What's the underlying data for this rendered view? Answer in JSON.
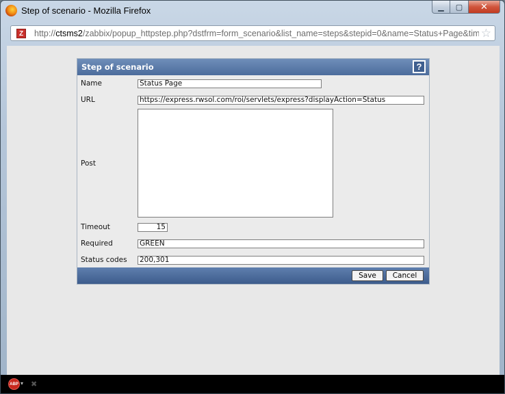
{
  "window": {
    "title": "Step of scenario - Mozilla Firefox",
    "url_prefix": "http://",
    "url_host": "ctsms2",
    "url_rest": "/zabbix/popup_httpstep.php?dstfrm=form_scenario&list_name=steps&stepid=0&name=Status+Page&timec"
  },
  "dialog": {
    "title": "Step of scenario",
    "help_label": "?",
    "fields": {
      "name": {
        "label": "Name",
        "value": "Status Page"
      },
      "url": {
        "label": "URL",
        "value": "https://express.rwsol.com/roi/servlets/express?displayAction=Status"
      },
      "post": {
        "label": "Post",
        "value": ""
      },
      "timeout": {
        "label": "Timeout",
        "value": "15"
      },
      "required": {
        "label": "Required",
        "value": "GREEN"
      },
      "status_codes": {
        "label": "Status codes",
        "value": "200,301"
      }
    },
    "buttons": {
      "save": "Save",
      "cancel": "Cancel"
    }
  },
  "statusbar": {
    "abp_label": "ABP"
  },
  "icons": {
    "firefox": "firefox-icon",
    "site": "zabbix-favicon",
    "bookmark": "star-icon",
    "help": "help-icon",
    "adblock": "adblock-icon"
  }
}
